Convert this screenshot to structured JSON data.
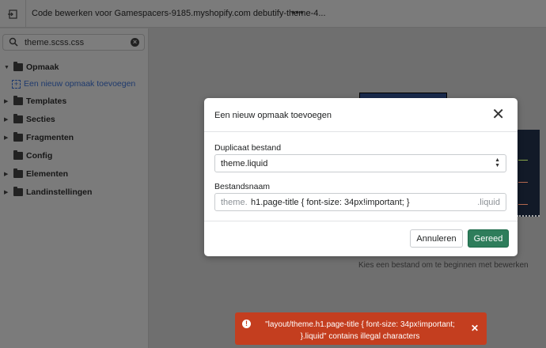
{
  "header": {
    "title": "Code bewerken voor Gamespacers-9185.myshopify.com debutify-theme-4...",
    "more": "•••"
  },
  "sidebar": {
    "search_value": "theme.scss.css",
    "items": [
      {
        "label": "Opmaak"
      },
      {
        "label": "Een nieuw opmaak toevoegen"
      },
      {
        "label": "Templates"
      },
      {
        "label": "Secties"
      },
      {
        "label": "Fragmenten"
      },
      {
        "label": "Config"
      },
      {
        "label": "Elementen"
      },
      {
        "label": "Landinstellingen"
      }
    ]
  },
  "main": {
    "empty_text": "Kies een bestand om te beginnen met bewerken"
  },
  "modal": {
    "title": "Een nieuw opmaak toevoegen",
    "duplicate_label": "Duplicaat bestand",
    "duplicate_value": "theme.liquid",
    "filename_label": "Bestandsnaam",
    "filename_prefix": "theme.",
    "filename_value": "h1.page-title { font-size: 34px!important; }",
    "filename_suffix": ".liquid",
    "cancel": "Annuleren",
    "confirm": "Gereed"
  },
  "toast": {
    "message": "\"layout/theme.h1.page-title { font-size: 34px!important; }.liquid\" contains illegal characters",
    "color": "#c43e1f"
  }
}
